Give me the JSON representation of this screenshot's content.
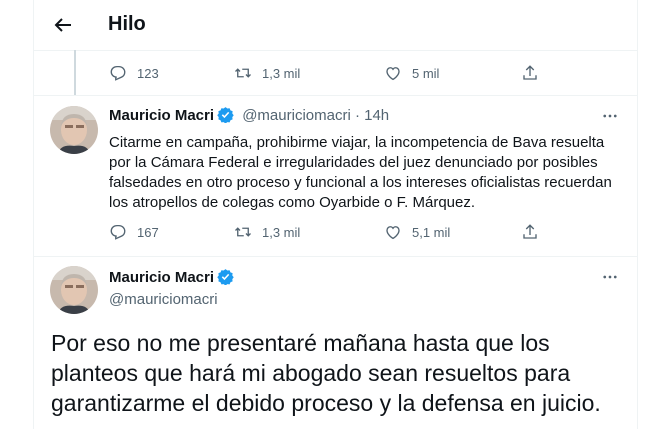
{
  "header": {
    "title": "Hilo"
  },
  "prev_tweet_actions": {
    "replies": "123",
    "retweets": "1,3 mil",
    "likes": "5 mil"
  },
  "reply_tweet": {
    "name": "Mauricio Macri",
    "handle": "@mauriciomacri",
    "separator": "·",
    "time": "14h",
    "text": "Citarme en campaña, prohibirme viajar, la incompetencia de Bava resuelta por la Cámara Federal e irregularidades del juez denunciado por posibles falsedades en otro proceso y funcional a los intereses oficialistas recuerdan los atropellos de colegas como Oyarbide o F. Márquez.",
    "replies": "167",
    "retweets": "1,3 mil",
    "likes": "5,1 mil"
  },
  "main_tweet": {
    "name": "Mauricio Macri",
    "handle": "@mauriciomacri",
    "text": "Por eso no me presentaré mañana hasta que los planteos que hará mi abogado sean resueltos para garantizarme el debido proceso y la defensa en juicio."
  },
  "colors": {
    "accent": "#1d9bf0",
    "text": "#0f1419",
    "muted": "#536471",
    "border": "#eff3f4"
  }
}
